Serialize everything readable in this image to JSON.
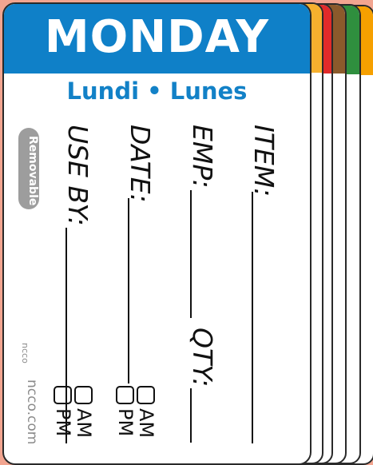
{
  "stack_colors": [
    "#f6b02e",
    "#e12a2a",
    "#8b5a2b",
    "#2f8f3e",
    "#f6a000"
  ],
  "header": {
    "day": "MONDAY",
    "color": "#0f80c8"
  },
  "subtitle": "Lundi • Lunes",
  "fields": {
    "item": "ITEM:",
    "emp": "EMP:",
    "qty": "QTY:",
    "date": "DATE:",
    "use_by": "USE BY:"
  },
  "checkbox_labels": {
    "am": "AM",
    "pm": "PM"
  },
  "badge": "Removable",
  "brand": {
    "logo": "ncco",
    "url": "ncco.com"
  }
}
